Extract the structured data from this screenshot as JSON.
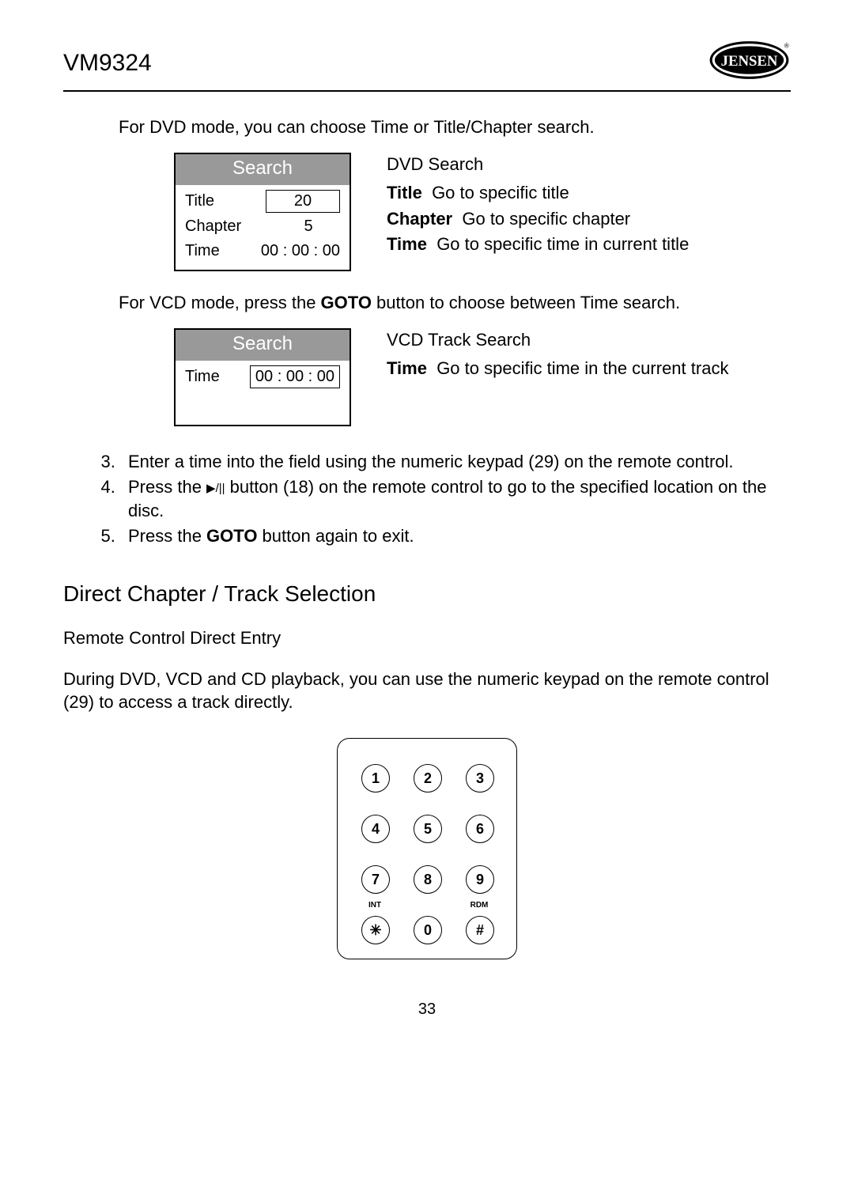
{
  "header": {
    "model": "VM9324",
    "brand": "JENSEN"
  },
  "intro_dvd": "For DVD mode, you can choose Time or Title/Chapter search.",
  "dvd_panel": {
    "header": "Search",
    "rows": {
      "title_label": "Title",
      "title_value": "20",
      "chapter_label": "Chapter",
      "chapter_value": "5",
      "time_label": "Time",
      "time_value": "00 : 00 : 00"
    }
  },
  "dvd_side": {
    "title": "DVD Search",
    "title_bold": "Title",
    "title_text": "Go to specific title",
    "chapter_bold": "Chapter",
    "chapter_text": "Go to specific chapter",
    "time_bold": "Time",
    "time_text": "Go to specific time in current title"
  },
  "intro_vcd_before": "For VCD mode, press the ",
  "intro_vcd_bold": "GOTO",
  "intro_vcd_after": " button to choose between Time search.",
  "vcd_panel": {
    "header": "Search",
    "time_label": "Time",
    "time_value": "00 : 00 : 00"
  },
  "vcd_side": {
    "title": "VCD Track Search",
    "time_bold": "Time",
    "time_text": "Go to specific time in the current track"
  },
  "steps": {
    "s3": "Enter a time into the field using the numeric keypad (29) on the remote control.",
    "s4_before": "Press the ",
    "s4_glyph": "▶/||",
    "s4_after": " button (18) on the remote control to go to the specified location on the disc.",
    "s5_before": "Press the ",
    "s5_bold": "GOTO",
    "s5_after": " button again to exit."
  },
  "section_heading": "Direct Chapter / Track Selection",
  "sub_heading": "Remote Control Direct Entry",
  "body_text": "During DVD, VCD and CD playback, you can use the numeric keypad on the remote control (29) to access a track directly.",
  "keypad": {
    "k1": "1",
    "k2": "2",
    "k3": "3",
    "k4": "4",
    "k5": "5",
    "k6": "6",
    "k7": "7",
    "k8": "8",
    "k9": "9",
    "k0": "0",
    "star": "✳",
    "hash": "#",
    "label_int": "INT",
    "label_rdm": "RDM"
  },
  "page_number": "33"
}
